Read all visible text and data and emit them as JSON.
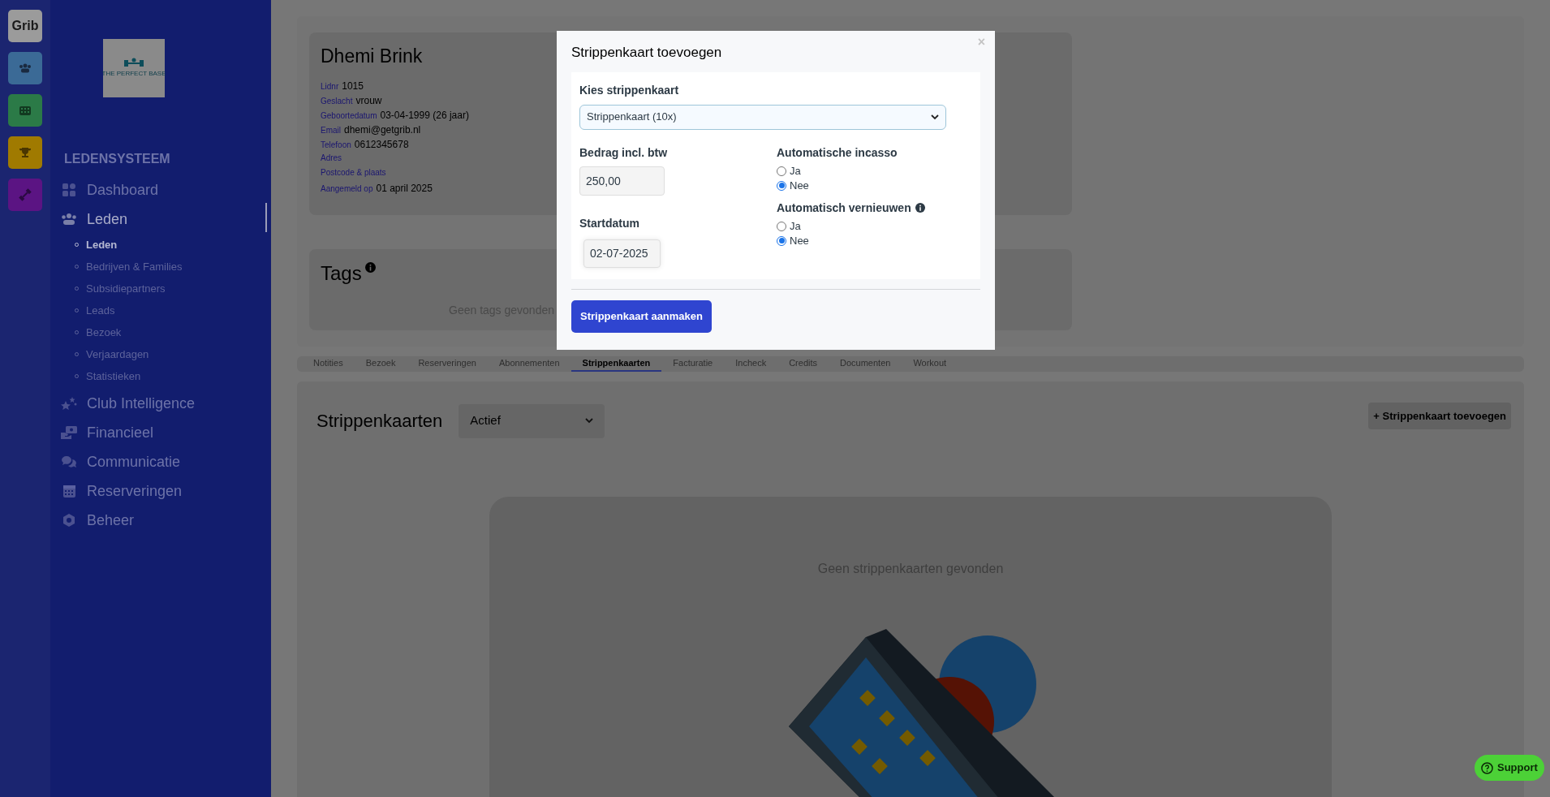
{
  "rail": [
    {
      "kind": "text",
      "label": "Grib",
      "color": "#9b9b9b"
    },
    {
      "kind": "icon",
      "color": "#3b6a96"
    },
    {
      "kind": "icon",
      "color": "#2b7a47"
    },
    {
      "kind": "icon",
      "color": "#a07a00"
    },
    {
      "kind": "icon",
      "color": "#5b1483"
    }
  ],
  "sidebar": {
    "logo_text": "THE PERFECT BASE",
    "section": "LEDENSYSTEEM",
    "items": [
      {
        "label": "Dashboard",
        "selected": false
      },
      {
        "label": "Leden",
        "selected": true,
        "children": [
          {
            "label": "Leden",
            "selected": true
          },
          {
            "label": "Bedrijven & Families",
            "selected": false
          },
          {
            "label": "Subsidiepartners",
            "selected": false
          },
          {
            "label": "Leads",
            "selected": false
          },
          {
            "label": "Bezoek",
            "selected": false
          },
          {
            "label": "Verjaardagen",
            "selected": false
          },
          {
            "label": "Statistieken",
            "selected": false
          }
        ]
      },
      {
        "label": "Club Intelligence",
        "selected": false
      },
      {
        "label": "Financieel",
        "selected": false
      },
      {
        "label": "Communicatie",
        "selected": false
      },
      {
        "label": "Reserveringen",
        "selected": false
      },
      {
        "label": "Beheer",
        "selected": false
      }
    ]
  },
  "profile": {
    "name": "Dhemi Brink",
    "fields": [
      {
        "label": "Lidnr",
        "value": "1015"
      },
      {
        "label": "Geslacht",
        "value": "vrouw"
      },
      {
        "label": "Geboortedatum",
        "value": "03-04-1999 (26 jaar)"
      },
      {
        "label": "Email",
        "value": "dhemi@getgrib.nl"
      },
      {
        "label": "Telefoon",
        "value": "0612345678"
      },
      {
        "label": "Adres"
      },
      {
        "label": "Postcode & plaats"
      },
      {
        "label": "Aangemeld op",
        "value": "01 april 2025"
      }
    ]
  },
  "tags": {
    "title": "Tags",
    "empty": "Geen tags gevonden"
  },
  "tabs": [
    {
      "label": "Notities",
      "selected": false
    },
    {
      "label": "Bezoek",
      "selected": false
    },
    {
      "label": "Reserveringen",
      "selected": false
    },
    {
      "label": "Abonnementen",
      "selected": false
    },
    {
      "label": "Strippenkaarten",
      "selected": true
    },
    {
      "label": "Facturatie",
      "selected": false
    },
    {
      "label": "Incheck",
      "selected": false
    },
    {
      "label": "Credits",
      "selected": false
    },
    {
      "label": "Documenten",
      "selected": false
    },
    {
      "label": "Workout",
      "selected": false
    }
  ],
  "strippenkaarten": {
    "title": "Strippenkaarten",
    "filter": "Actief",
    "add_button": "+ Strippenkaart toevoegen",
    "empty": "Geen strippenkaarten gevonden"
  },
  "modal": {
    "title": "Strippenkaart toevoegen",
    "close": "×",
    "select_label": "Kies strippenkaart",
    "select_value": "Strippenkaart (10x)",
    "amount_label": "Bedrag incl. btw",
    "amount_value": "250,00",
    "start_label": "Startdatum",
    "start_value": "02-07-2025",
    "groups": [
      {
        "label": "Automatische incasso",
        "info": false,
        "options": [
          {
            "label": "Ja",
            "selected": false
          },
          {
            "label": "Nee",
            "selected": true
          }
        ]
      },
      {
        "label": "Automatisch vernieuwen",
        "info": true,
        "options": [
          {
            "label": "Ja",
            "selected": false
          },
          {
            "label": "Nee",
            "selected": true
          }
        ]
      }
    ],
    "submit": "Strippenkaart aanmaken"
  },
  "support": "Support"
}
